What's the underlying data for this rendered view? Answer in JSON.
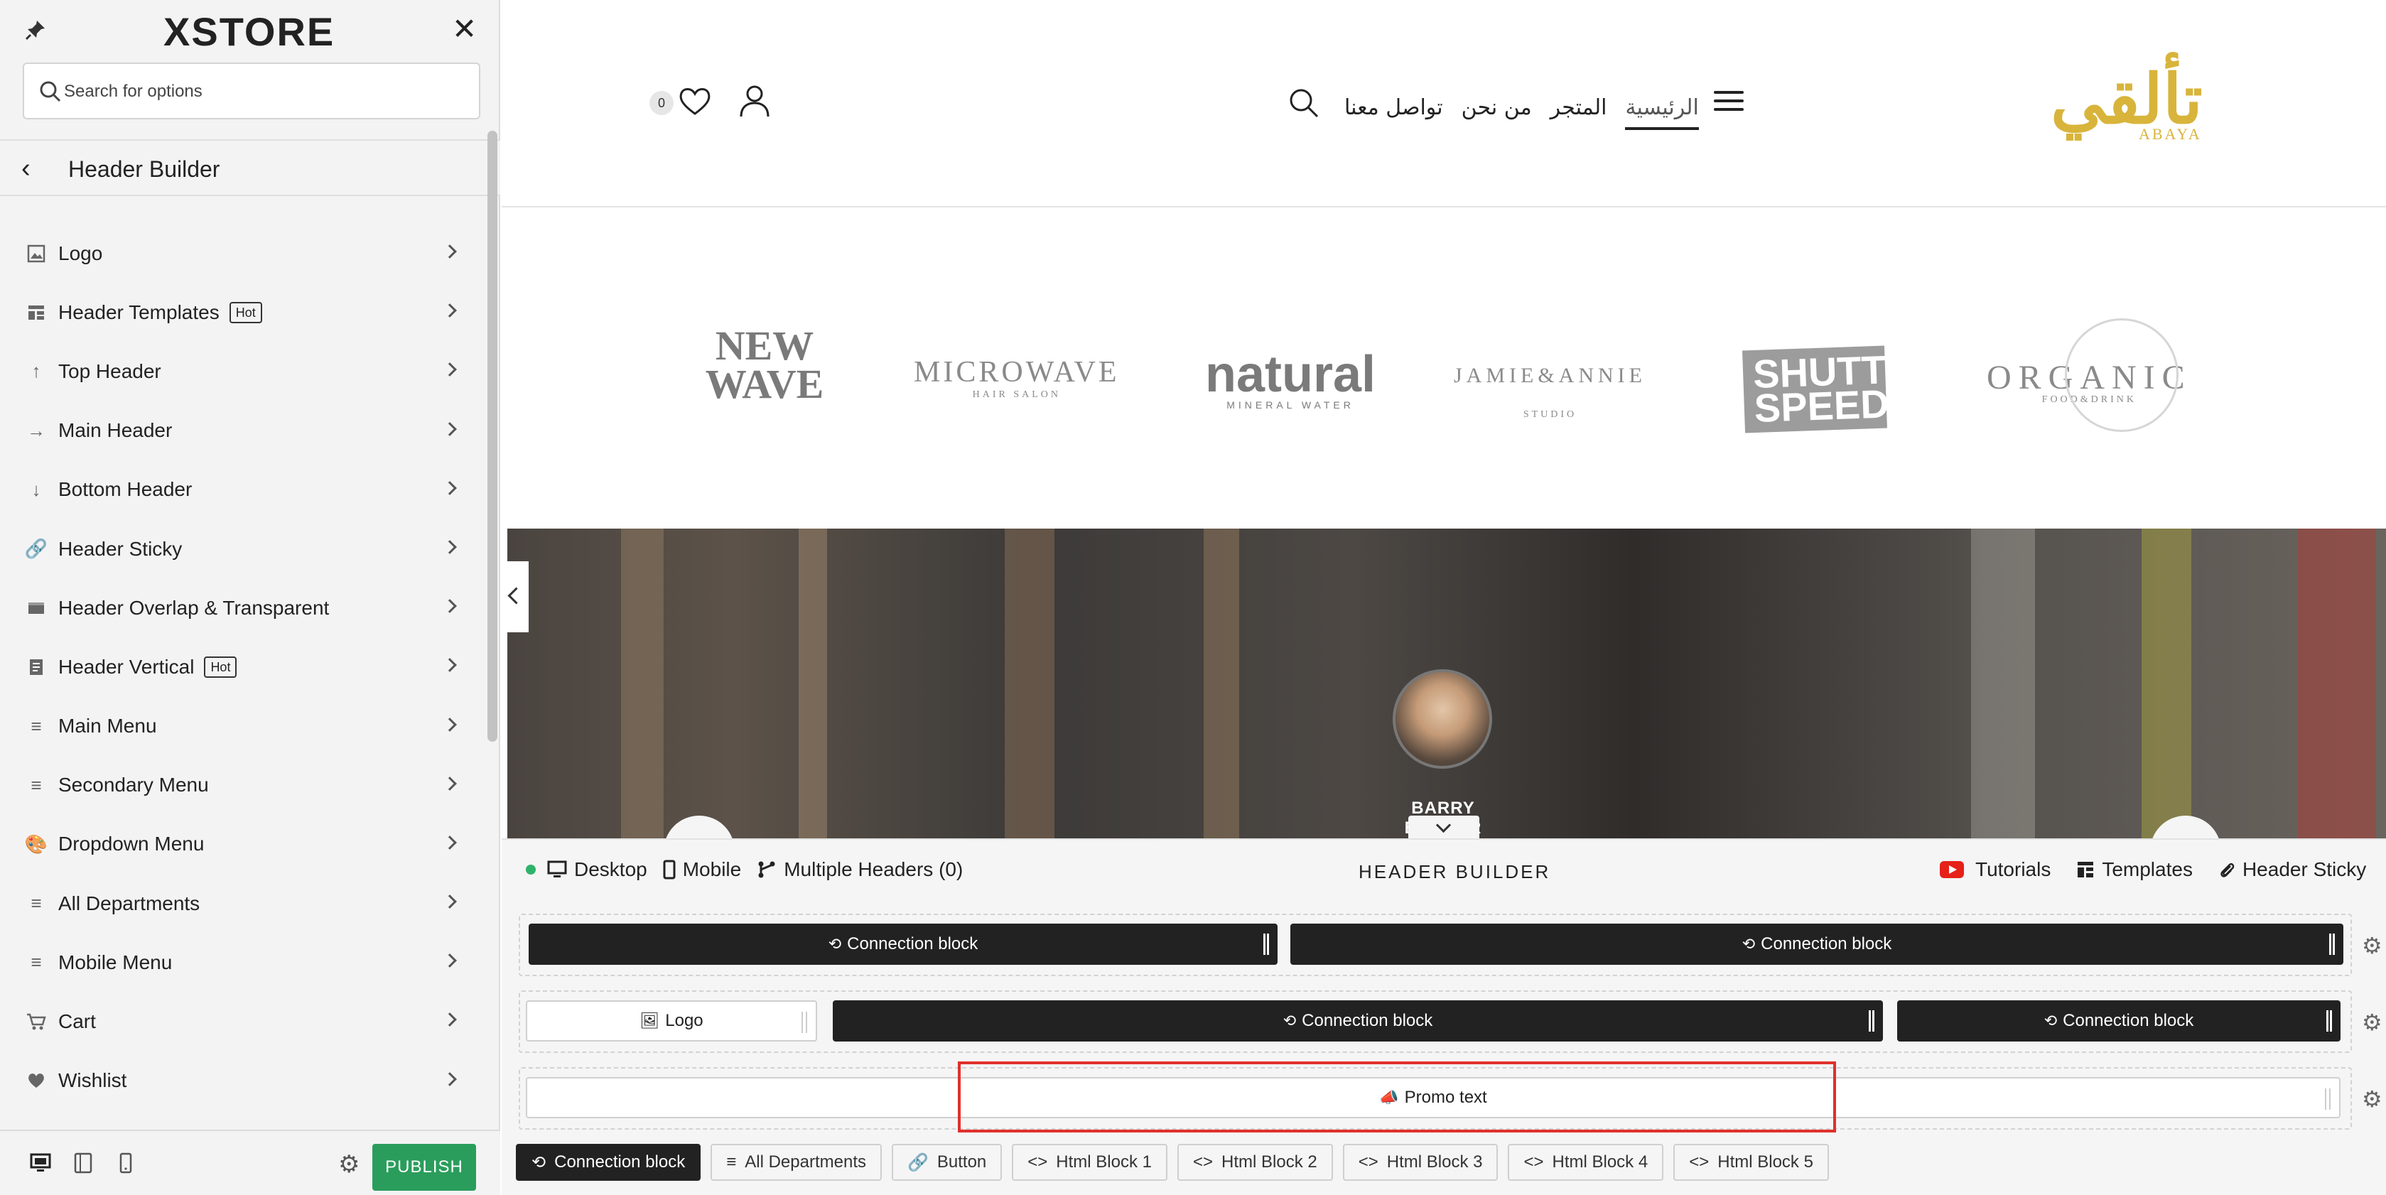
{
  "sidebar": {
    "brand": "XSTORE",
    "search_placeholder": "Search for options",
    "section_title": "Header Builder",
    "items": [
      {
        "label": "Logo",
        "badge": ""
      },
      {
        "label": "Header Templates",
        "badge": "Hot"
      },
      {
        "label": "Top Header",
        "badge": ""
      },
      {
        "label": "Main Header",
        "badge": ""
      },
      {
        "label": "Bottom Header",
        "badge": ""
      },
      {
        "label": "Header Sticky",
        "badge": ""
      },
      {
        "label": "Header Overlap & Transparent",
        "badge": ""
      },
      {
        "label": "Header Vertical",
        "badge": "Hot"
      },
      {
        "label": "Main Menu",
        "badge": ""
      },
      {
        "label": "Secondary Menu",
        "badge": ""
      },
      {
        "label": "Dropdown Menu",
        "badge": ""
      },
      {
        "label": "All Departments",
        "badge": ""
      },
      {
        "label": "Mobile Menu",
        "badge": ""
      },
      {
        "label": "Cart",
        "badge": ""
      },
      {
        "label": "Wishlist",
        "badge": ""
      }
    ],
    "publish_label": "PUBLISH"
  },
  "site": {
    "nav": [
      "الرئيسية",
      "المتجر",
      "من نحن",
      "تواصل معنا"
    ],
    "logo_text": "تألقي",
    "logo_sub": "ABAYA",
    "wishlist_count": "0",
    "brands": {
      "newwave": "NEW WAVE",
      "microwave": "MICROWAVE",
      "microwave_sub": "HAIR SALON",
      "natural": "natural",
      "natural_sub": "MINERAL WATER",
      "jamie": "JAMIE&ANNIE",
      "jamie_sub": "STUDIO",
      "shutter": "SHUTTER SPEED",
      "organic": "ORGANIC",
      "organic_sub": "FOOD&DRINK"
    },
    "testimonial_name": "BARRY BARKER"
  },
  "builder": {
    "devices": {
      "desktop": "Desktop",
      "mobile": "Mobile",
      "multiple": "Multiple Headers (0)"
    },
    "title": "HEADER BUILDER",
    "links": {
      "tutorials": "Tutorials",
      "templates": "Templates",
      "sticky": "Header Sticky"
    },
    "row1": {
      "left": "Connection block",
      "right": "Connection block"
    },
    "row2": {
      "logo": "Logo",
      "middle": "Connection block",
      "right": "Connection block"
    },
    "row3": {
      "promo": "Promo text"
    },
    "chips": [
      "Connection block",
      "All Departments",
      "Button",
      "Html Block 1",
      "Html Block 2",
      "Html Block 3",
      "Html Block 4",
      "Html Block 5"
    ]
  }
}
